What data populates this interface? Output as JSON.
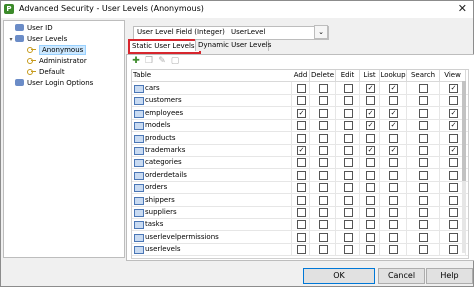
{
  "window": {
    "title": "Advanced Security - User Levels (Anonymous)",
    "icon": "app-logo-icon",
    "close_glyph": "✕"
  },
  "tree": [
    {
      "label": "User ID",
      "icon": "user-icon",
      "indent": 0,
      "expander": ""
    },
    {
      "label": "User Levels",
      "icon": "user-icon",
      "indent": 0,
      "expander": "▾"
    },
    {
      "label": "Anonymous",
      "icon": "key-icon",
      "indent": 1,
      "expander": "",
      "selected": true
    },
    {
      "label": "Administrator",
      "icon": "key-icon",
      "indent": 1,
      "expander": ""
    },
    {
      "label": "Default",
      "icon": "key-icon",
      "indent": 1,
      "expander": ""
    },
    {
      "label": "User Login Options",
      "icon": "user-icon",
      "indent": 0,
      "expander": ""
    }
  ],
  "field": {
    "label": "User Level Field (Integer)",
    "value": "UserLevel",
    "dropdown_glyph": "⌄"
  },
  "tabs": [
    {
      "label": "Static User Levels",
      "active": true
    },
    {
      "label": "Dynamic User Levels",
      "active": false
    }
  ],
  "toolbar": {
    "icons": [
      "add-icon",
      "copy-icon",
      "edit-icon",
      "delete-icon"
    ],
    "glyphs": [
      "✚",
      "❐",
      "✎",
      "▢"
    ]
  },
  "grid": {
    "columns": [
      "Table",
      "Add",
      "Delete",
      "Edit",
      "List",
      "Lookup",
      "Search",
      "View"
    ],
    "rows": [
      {
        "name": "cars",
        "perms": [
          false,
          false,
          false,
          true,
          true,
          false,
          true
        ]
      },
      {
        "name": "customers",
        "perms": [
          false,
          false,
          false,
          false,
          false,
          false,
          false
        ]
      },
      {
        "name": "employees",
        "perms": [
          true,
          false,
          false,
          true,
          true,
          false,
          true
        ]
      },
      {
        "name": "models",
        "perms": [
          false,
          false,
          false,
          true,
          true,
          false,
          true
        ]
      },
      {
        "name": "products",
        "perms": [
          false,
          false,
          false,
          false,
          false,
          false,
          false
        ]
      },
      {
        "name": "trademarks",
        "perms": [
          true,
          false,
          false,
          true,
          true,
          false,
          true
        ]
      },
      {
        "name": "categories",
        "perms": [
          false,
          false,
          false,
          false,
          false,
          false,
          false
        ]
      },
      {
        "name": "orderdetails",
        "perms": [
          false,
          false,
          false,
          false,
          false,
          false,
          false
        ]
      },
      {
        "name": "orders",
        "perms": [
          false,
          false,
          false,
          false,
          false,
          false,
          false
        ]
      },
      {
        "name": "shippers",
        "perms": [
          false,
          false,
          false,
          false,
          false,
          false,
          false
        ]
      },
      {
        "name": "suppliers",
        "perms": [
          false,
          false,
          false,
          false,
          false,
          false,
          false
        ]
      },
      {
        "name": "tasks",
        "perms": [
          false,
          false,
          false,
          false,
          false,
          false,
          false
        ]
      },
      {
        "name": "userlevelpermissions",
        "perms": [
          false,
          false,
          false,
          false,
          false,
          false,
          false
        ]
      },
      {
        "name": "userlevels",
        "perms": [
          false,
          false,
          false,
          false,
          false,
          false,
          false
        ]
      }
    ]
  },
  "buttons": {
    "ok": "OK",
    "cancel": "Cancel",
    "help": "Help"
  },
  "colors": {
    "selection": "#cce8ff",
    "highlight_border": "#d7262e",
    "primary_button_border": "#0078d7"
  }
}
